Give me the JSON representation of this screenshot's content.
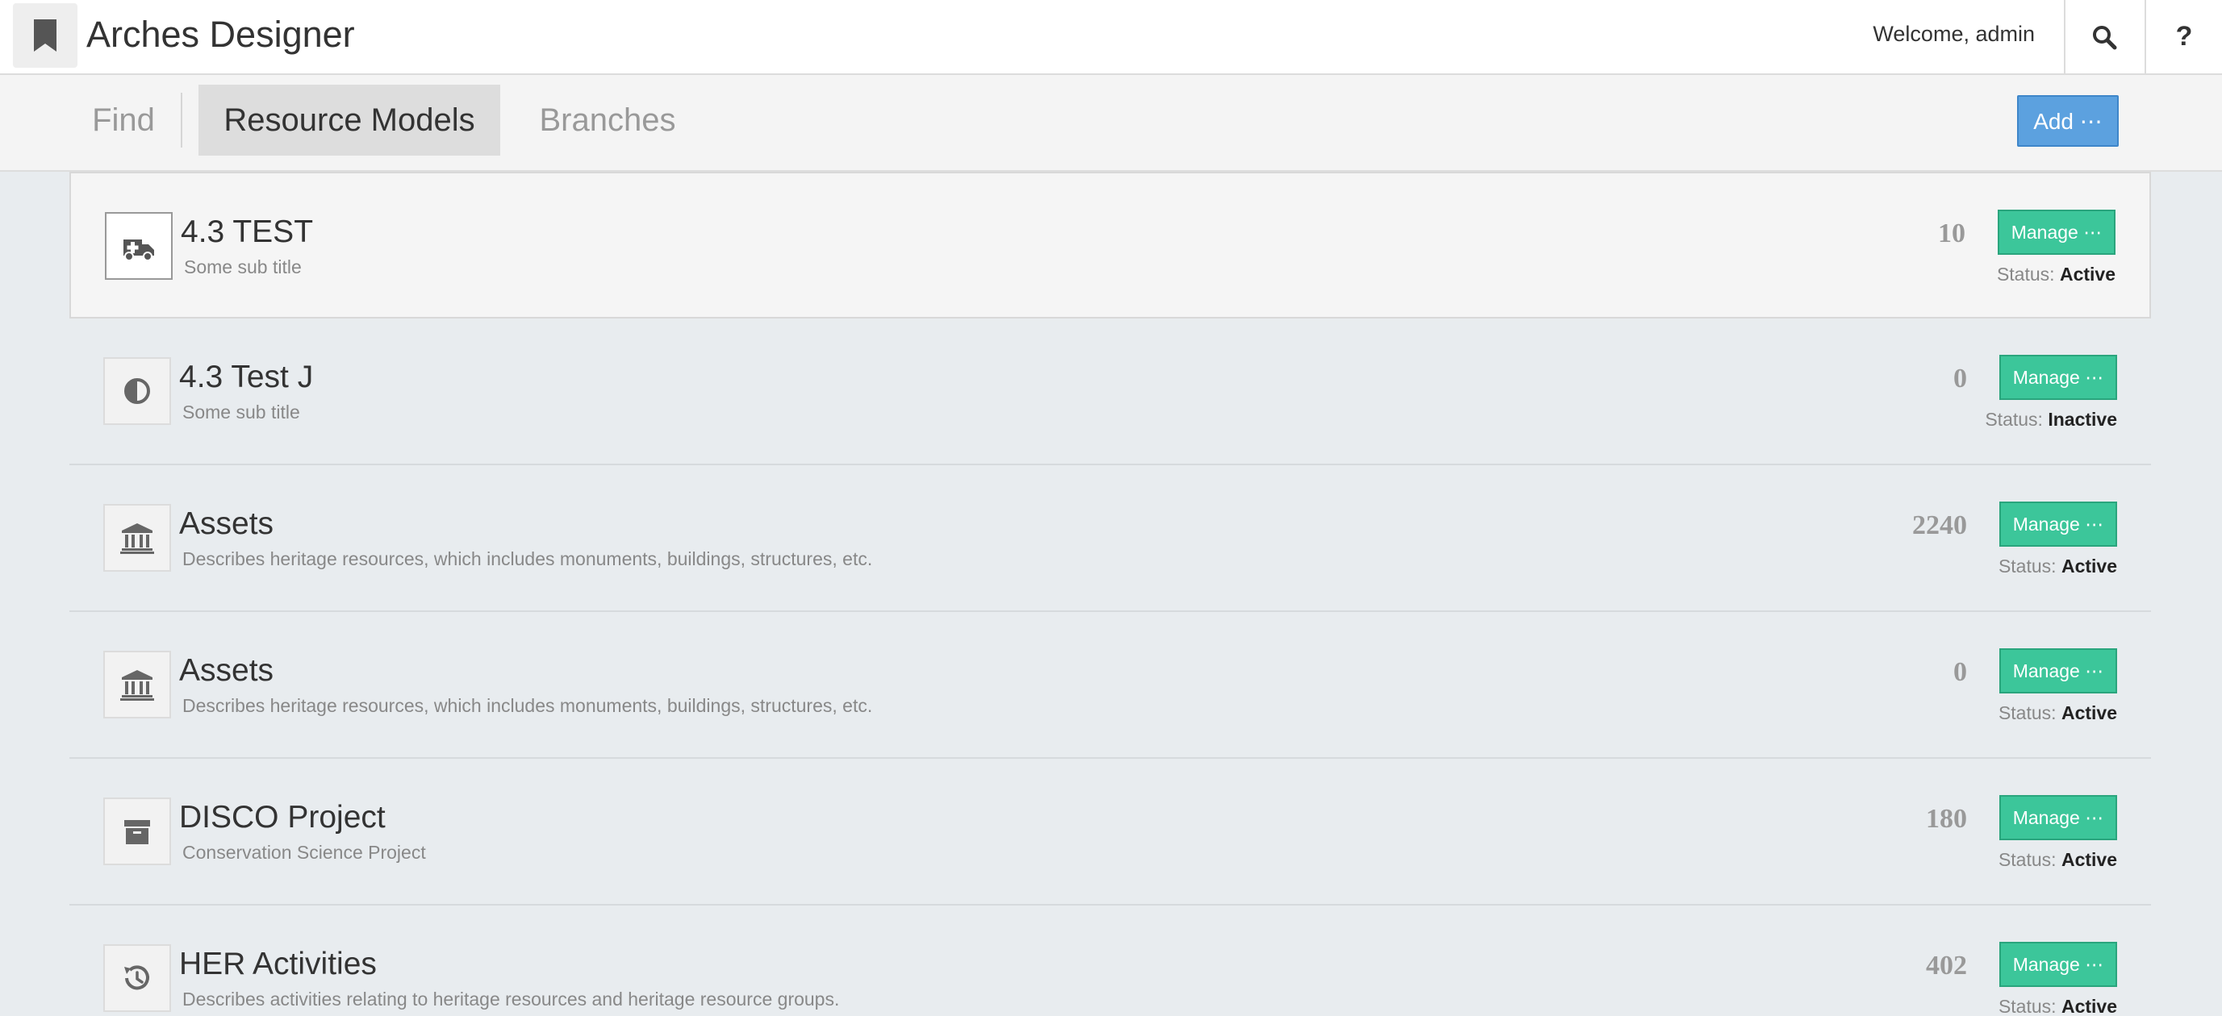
{
  "header": {
    "app_title": "Arches Designer",
    "welcome": "Welcome, admin",
    "help_label": "?"
  },
  "tabs": [
    {
      "label": "Find"
    },
    {
      "label": "Resource Models"
    },
    {
      "label": "Branches"
    }
  ],
  "active_tab": "Resource Models",
  "add_label": "Add ⋯",
  "manage_label": "Manage ⋯",
  "status_prefix": "Status:",
  "models": [
    {
      "title": "4.3 TEST",
      "subtitle": "Some sub title",
      "count": "10",
      "status": "Active",
      "icon": "ambulance-icon"
    },
    {
      "title": "4.3 Test J",
      "subtitle": "Some sub title",
      "count": "0",
      "status": "Inactive",
      "icon": "half-circle-icon"
    },
    {
      "title": "Assets",
      "subtitle": "Describes heritage resources, which includes monuments, buildings, structures, etc.",
      "count": "2240",
      "status": "Active",
      "icon": "bank-icon"
    },
    {
      "title": "Assets",
      "subtitle": "Describes heritage resources, which includes monuments, buildings, structures, etc.",
      "count": "0",
      "status": "Active",
      "icon": "bank-icon"
    },
    {
      "title": "DISCO Project",
      "subtitle": "Conservation Science Project",
      "count": "180",
      "status": "Active",
      "icon": "archive-box-icon"
    },
    {
      "title": "HER Activities",
      "subtitle": "Describes activities relating to heritage resources and heritage resource groups.",
      "count": "402",
      "status": "Active",
      "icon": "history-icon"
    }
  ],
  "colors": {
    "add_button": "#5ca1df",
    "manage_button": "#3cc69a",
    "page_background": "#e8ecef"
  }
}
